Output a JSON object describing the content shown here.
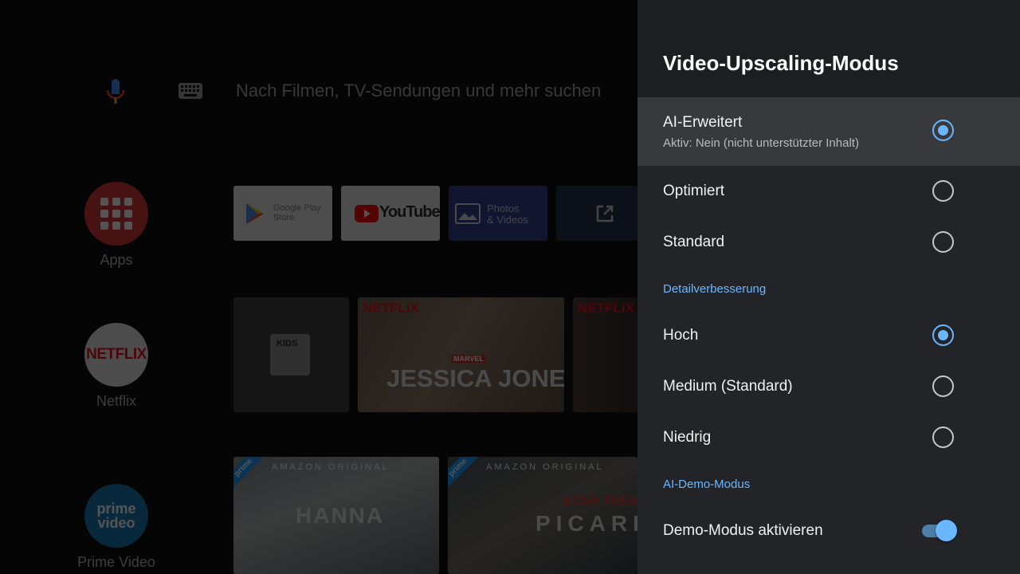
{
  "launcher": {
    "search_placeholder": "Nach Filmen, TV-Sendungen und mehr suchen",
    "rail": [
      {
        "label": "Apps",
        "icon": "apps-grid-icon"
      },
      {
        "label": "Netflix",
        "icon": "netflix-logo",
        "logo_text": "NETFLIX"
      },
      {
        "label": "Prime Video",
        "icon": "prime-video-logo",
        "logo_line1": "prime",
        "logo_line2": "video"
      }
    ],
    "app_tiles": [
      {
        "name": "Google Play Store",
        "line1": "Google Play",
        "line2": "Store"
      },
      {
        "name": "YouTube",
        "text": "YouTube"
      },
      {
        "name": "Photos & Videos",
        "line1": "Photos",
        "line2": "& Videos"
      },
      {
        "name": "External link",
        "icon": "open-external-icon"
      }
    ],
    "netflix_row": {
      "kids_label": "KIDS",
      "badge": "NETFLIX",
      "show_title": "JESSICA JONES",
      "show_brand": "MARVEL"
    },
    "prime_row": {
      "corner": "prime",
      "banner": "AMAZON ORIGINAL",
      "titles": [
        "HANNA",
        "PICARD"
      ],
      "picard_brand": "STAR TREK"
    }
  },
  "panel": {
    "title": "Video-Upscaling-Modus",
    "upscaling_options": [
      {
        "label": "AI-Erweitert",
        "sub": "Aktiv: Nein (nicht unterstützter Inhalt)",
        "checked": true,
        "focused": true
      },
      {
        "label": "Optimiert",
        "checked": false
      },
      {
        "label": "Standard",
        "checked": false
      }
    ],
    "detail_section": "Detailverbesserung",
    "detail_options": [
      {
        "label": "Hoch",
        "checked": true
      },
      {
        "label": "Medium (Standard)",
        "checked": false
      },
      {
        "label": "Niedrig",
        "checked": false
      }
    ],
    "demo_section": "AI-Demo-Modus",
    "demo_toggle": {
      "label": "Demo-Modus aktivieren",
      "on": true
    }
  },
  "colors": {
    "accent": "#6ab7ff",
    "panel_bg": "#232428",
    "panel_header_bg": "#1d1e21",
    "focused_row_bg": "#38393d"
  }
}
